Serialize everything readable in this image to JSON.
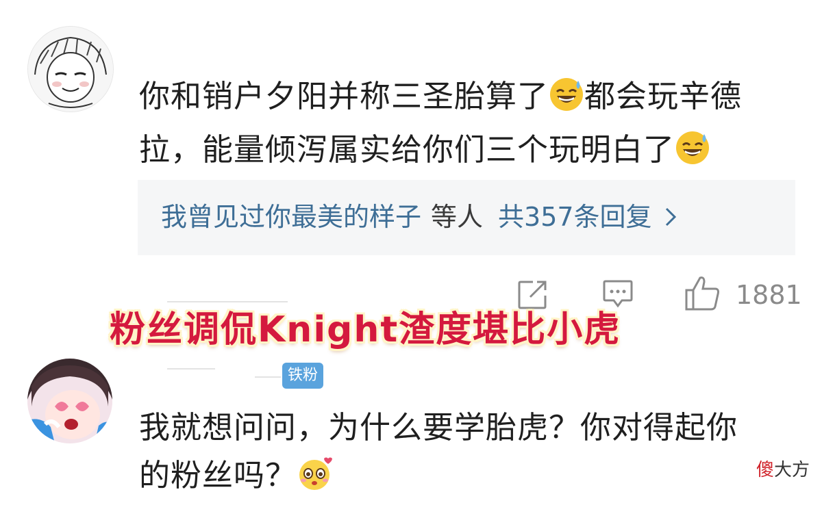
{
  "comments": [
    {
      "text_line1": "你和销户夕阳并称三圣胎算了",
      "text_line1_tail": "都会玩辛德",
      "text_line2": "拉，能量倾泻属实给你们三个玩明白了",
      "emoji": "sweat-smile-emoji",
      "replies": {
        "names": "我曾见过你最美的样子",
        "etc": "等人",
        "count": "共357条回复"
      },
      "actions": {
        "share_icon": "share-icon",
        "comment_icon": "comment-icon",
        "like_icon": "thumbs-up-icon",
        "like_count": "1881"
      }
    },
    {
      "badge": "铁粉",
      "text_line1": "我就想问问，为什么要学胎虎？你对得起你",
      "text_line2": "的粉丝吗？",
      "emoji": "heart-eyes-emoji"
    }
  ],
  "overlay_caption": "粉丝调侃Knight渣度堪比小虎",
  "watermark": {
    "first_char": "傻",
    "rest": "大方"
  },
  "colors": {
    "link_blue": "#3e6e96",
    "caption_red": "#d4193e",
    "badge_blue": "#5aa3dd"
  }
}
